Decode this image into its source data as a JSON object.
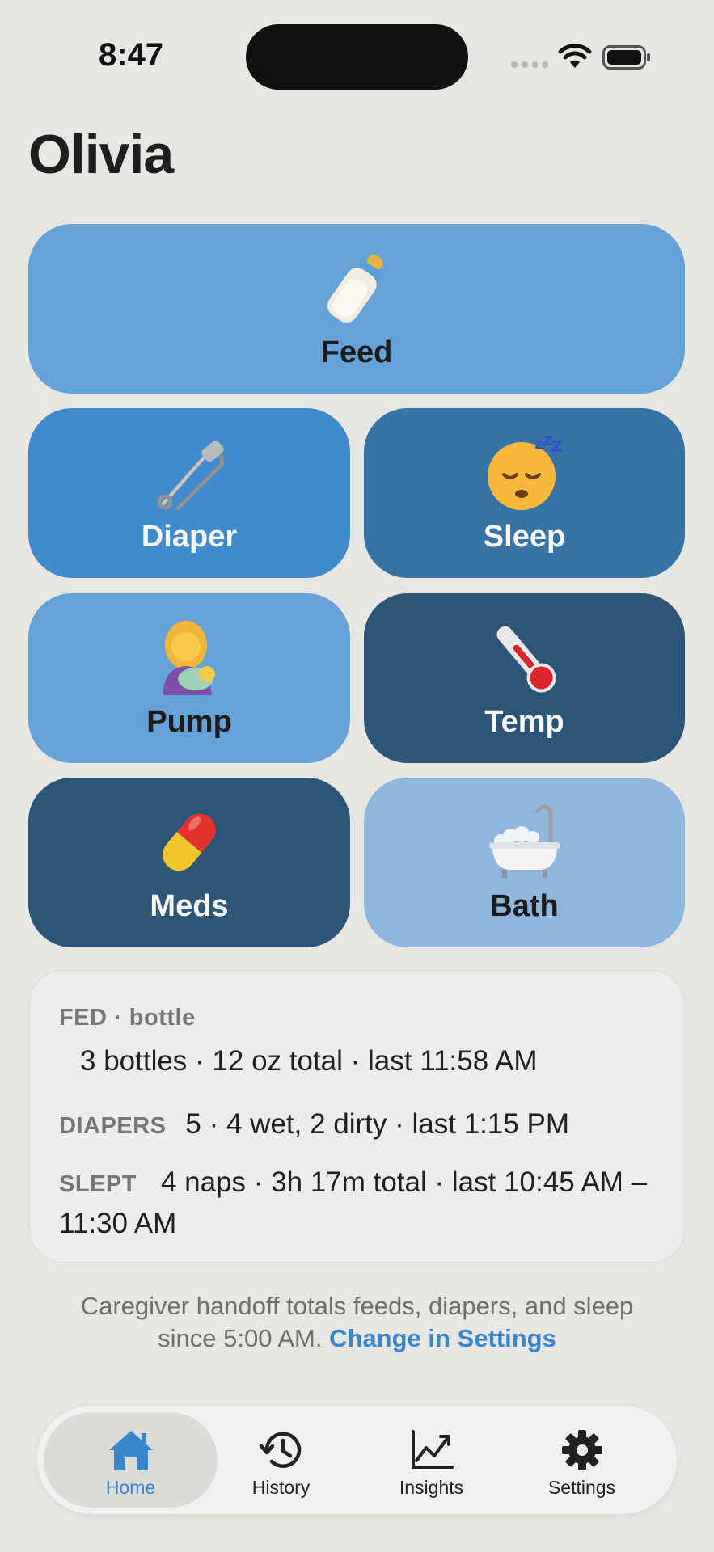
{
  "status": {
    "time": "8:47"
  },
  "title": "Olivia",
  "tiles": {
    "feed": "Feed",
    "diaper": "Diaper",
    "sleep": "Sleep",
    "pump": "Pump",
    "temp": "Temp",
    "meds": "Meds",
    "bath": "Bath"
  },
  "summary": {
    "fed_caption": "FED · bottle",
    "fed_value": "3 bottles · 12 oz total · last 11:58 AM",
    "diapers_caption": "DIAPERS",
    "diapers_value": "5 · 4 wet, 2 dirty · last 1:15 PM",
    "slept_caption": "SLEPT",
    "slept_value": "4 naps · 3h 17m total · last 10:45 AM – 11:30 AM"
  },
  "footnote": {
    "text": "Caregiver handoff totals feeds, diapers, and sleep since 5:00 AM.",
    "link": "Change in Settings"
  },
  "tabs": {
    "home": "Home",
    "history": "History",
    "insights": "Insights",
    "settings": "Settings"
  },
  "colors": {
    "accent": "#3a86cc",
    "feed": "#65a2d6",
    "diaper": "#418acc",
    "sleep": "#3873a6",
    "temp": "#2c5578",
    "bath": "#8fb6dc"
  }
}
